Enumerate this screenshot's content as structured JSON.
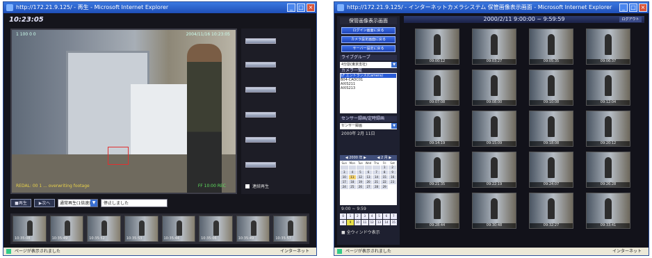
{
  "win1": {
    "title": "http://172.21.9.125/ - 再生 - Microsoft Internet Explorer",
    "clock": "10:23:05",
    "video": {
      "camera": "1 100 0 0",
      "timestamp": "2004/11/16 10:23:05",
      "warning": "REDAL: 00 1 ... overwriting footage",
      "caption": "FF 10:00 REC"
    },
    "checkbox_label": "連続再生",
    "controls": {
      "play": "■再生",
      "next": "▶次へ",
      "select_value": "通常再生(1倍速)",
      "status": "停止しました"
    },
    "thumbs": [
      "10:35:08",
      "10:35:49",
      "10:35:52",
      "10:35:53",
      "10:35:44",
      "10:35:06",
      "10:35:49",
      "10:35:57"
    ],
    "status_left": "ページが表示されました",
    "status_right": "インターネット"
  },
  "win2": {
    "title": "http://172.21.9.125/ - インターネットカメラシステム 保管画像表示画面 - Microsoft Internet Explorer",
    "header": "2000/2/11 9:00:00 ~ 9:59:59",
    "header_btn": "ログアウト",
    "side": {
      "title": "保管画像表示画面",
      "buttons": [
        "ログイン画面に戻る",
        "カメラ設定画面に戻る",
        "サーバー設定に戻る"
      ],
      "section_group": "ライブグループ",
      "group_select": "4分割(東京支社)",
      "section_camera": "カメラ一覧",
      "cameras": [
        "1F エントランス(Camera)",
        "B04-CAOC01",
        "AXIS211",
        "AXIS213"
      ],
      "section_search": "センサー録画/定時録画",
      "search_select": "センサー録画",
      "date_label": "2000年 2月 11日",
      "cal_nav": [
        "◀ 2000 年 ▶",
        "◀ 2 月 ▶"
      ],
      "weekdays": [
        "Sun",
        "Mon",
        "Tue",
        "Wed",
        "Thu",
        "Fri",
        "Sat"
      ],
      "days": [
        "",
        "",
        "",
        "",
        "",
        "1",
        "2",
        "3",
        "4",
        "5",
        "6",
        "7",
        "8",
        "9",
        "10",
        "11",
        "12",
        "13",
        "14",
        "15",
        "16",
        "17",
        "18",
        "19",
        "20",
        "21",
        "22",
        "23",
        "24",
        "25",
        "26",
        "27",
        "28",
        "29"
      ],
      "time_label": "9:00 ~ 9:59",
      "hours": [
        "0",
        "1",
        "2",
        "3",
        "4",
        "5",
        "6",
        "7",
        "8",
        "9",
        "10",
        "11",
        "12",
        "13",
        "14",
        "15"
      ],
      "bottom_label": "■ 全ウィンドウ表示"
    },
    "thumbs": [
      "09:00:12",
      "09:03:27",
      "09:05:35",
      "09:06:37",
      "09:07:08",
      "09:08:00",
      "09:10:08",
      "09:12:04",
      "09:14:19",
      "09:15:09",
      "09:18:08",
      "09:20:12",
      "09:21:35",
      "09:22:19",
      "09:24:07",
      "09:26:28",
      "09:28:44",
      "09:30:48",
      "09:32:27",
      "09:33:41"
    ],
    "status_left": "ページが表示されました",
    "status_right": "インターネット"
  }
}
